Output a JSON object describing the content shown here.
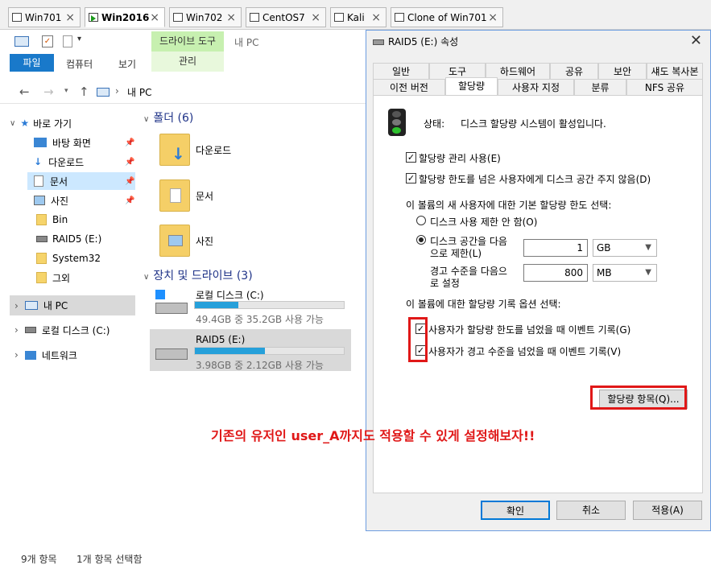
{
  "vm_tabs": [
    {
      "label": "Win701"
    },
    {
      "label": "Win2016"
    },
    {
      "label": "Win702"
    },
    {
      "label": "CentOS7"
    },
    {
      "label": "Kali"
    },
    {
      "label": "Clone of Win701"
    }
  ],
  "explorer": {
    "title": "내 PC",
    "ribbon": {
      "contextual_group": "드라이브 도구",
      "contextual_tab": "관리",
      "file_tab": "파일",
      "tabs": [
        "컴퓨터",
        "보기"
      ]
    },
    "address": "내 PC",
    "nav": {
      "quick_access": "바로 가기",
      "items": [
        "바탕 화면",
        "다운로드",
        "문서",
        "사진",
        "Bin",
        "RAID5 (E:)",
        "System32",
        "그외"
      ],
      "this_pc": "내 PC",
      "local_disk": "로컬 디스크 (C:)",
      "network": "네트워크"
    },
    "folders_header": "폴더 (6)",
    "folders": [
      "다운로드",
      "문서",
      "사진"
    ],
    "drives_header": "장치 및 드라이브 (3)",
    "drives": [
      {
        "name": "로컬 디스크 (C:)",
        "info": "49.4GB 중 35.2GB 사용 가능",
        "used_fraction": 0.29
      },
      {
        "name": "RAID5 (E:)",
        "info": "3.98GB 중 2.12GB 사용 가능",
        "used_fraction": 0.47
      }
    ],
    "status": {
      "count": "9개 항목",
      "selected": "1개 항목 선택함"
    }
  },
  "dialog": {
    "title": "RAID5 (E:) 속성",
    "tabs_row1": [
      "일반",
      "도구",
      "하드웨어",
      "공유",
      "보안",
      "섀도 복사본"
    ],
    "tabs_row2": [
      "이전 버전",
      "할당량",
      "사용자 지정",
      "분류",
      "NFS 공유"
    ],
    "status_label": "상태:",
    "status_value": "디스크 할당량 시스템이 활성입니다.",
    "cb_enable": "할당량 관리 사용(E)",
    "cb_deny": "할당량 한도를 넘은 사용자에게 디스크 공간 주지 않음(D)",
    "default_header": "이 볼륨의 새 사용자에 대한 기본 할당량 한도 선택:",
    "radio_nolimit": "디스크 사용 제한 안 함(O)",
    "radio_limit_1": "디스크 공간을 다음",
    "radio_limit_2": "으로 제한(L)",
    "limit_value": "1",
    "limit_unit": "GB",
    "warn_label_1": "경고 수준을 다음으",
    "warn_label_2": "로 설정",
    "warn_value": "800",
    "warn_unit": "MB",
    "log_header": "이 볼륨에 대한 할당량 기록 옵션 선택:",
    "cb_log_limit": "사용자가 할당량 한도를 넘었을 때 이벤트 기록(G)",
    "cb_log_warn": "사용자가 경고 수준을 넘었을 때 이벤트 기록(V)",
    "entries_button": "할당량 항목(Q)...",
    "ok": "확인",
    "cancel": "취소",
    "apply": "적용(A)"
  },
  "annotation": "기존의 유저인 user_A까지도 적용할 수 있게 설정해보자!!",
  "colors": {
    "accent": "#1979ca",
    "annotation": "#e01818",
    "progress": "#26a0da"
  }
}
